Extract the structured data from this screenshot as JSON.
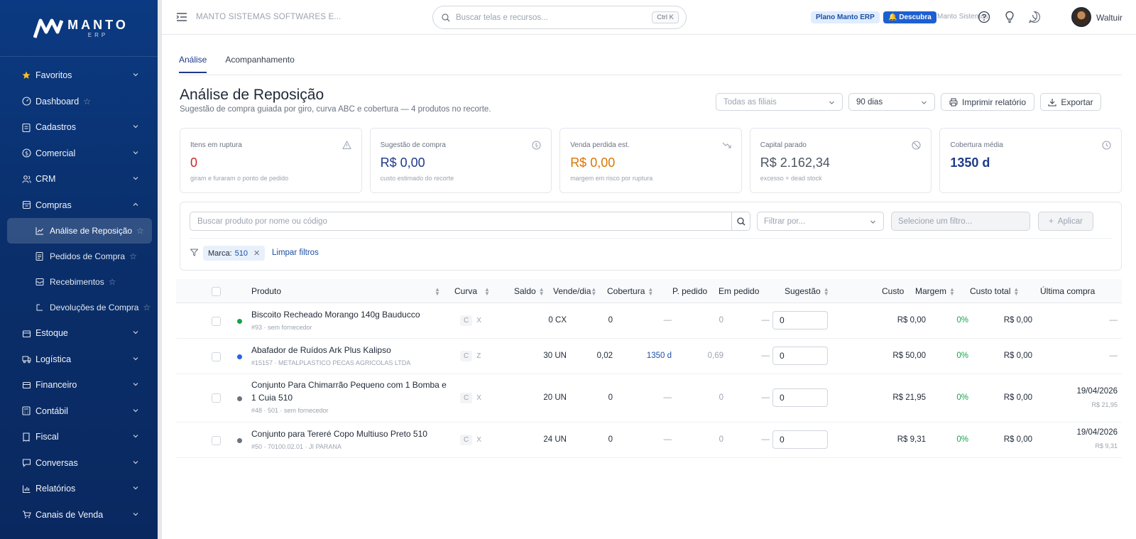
{
  "brand": {
    "name": "MANTO",
    "sub": "ERP"
  },
  "sidebar": {
    "items": [
      {
        "label": "Favoritos",
        "icon": "star-icon"
      },
      {
        "label": "Dashboard",
        "icon": "gauge-icon"
      },
      {
        "label": "Cadastros",
        "icon": "clipboard-icon"
      },
      {
        "label": "Comercial",
        "icon": "dollar-icon"
      },
      {
        "label": "CRM",
        "icon": "users-icon"
      },
      {
        "label": "Compras",
        "icon": "cart-icon"
      }
    ],
    "subitems": [
      {
        "label": "Análise de Reposição"
      },
      {
        "label": "Pedidos de Compra"
      },
      {
        "label": "Recebimentos"
      },
      {
        "label": "Devoluções de Compra"
      }
    ],
    "items_after": [
      {
        "label": "Estoque"
      },
      {
        "label": "Logística"
      },
      {
        "label": "Financeiro"
      },
      {
        "label": "Contábil"
      },
      {
        "label": "Fiscal"
      },
      {
        "label": "Conversas"
      },
      {
        "label": "Relatórios"
      },
      {
        "label": "Canais de Venda"
      }
    ]
  },
  "topbar": {
    "company": "MANTO SISTEMAS SOFTWARES E...",
    "search_placeholder": "Buscar telas e recursos...",
    "shortcut": "Ctrl K",
    "plan": "Plano Manto ERP",
    "discover": "Descubra",
    "tenant": "Manto Sistemas",
    "user": "Waltuir"
  },
  "tabs": [
    "Análise",
    "Acompanhamento"
  ],
  "page": {
    "title": "Análise de Reposição",
    "subtitle": "Sugestão de compra guiada por giro, curva ABC e cobertura — 4 produtos no recorte.",
    "branch_select": "Todas as filiais",
    "period_select": "90 dias",
    "print_label": "Imprimir relatório",
    "export_label": "Exportar"
  },
  "kpis": [
    {
      "label": "Itens em ruptura",
      "value": "0",
      "sub": "giram e furaram o ponto de pedido",
      "color": "#c62828"
    },
    {
      "label": "Sugestão de compra",
      "value": "R$ 0,00",
      "sub": "custo estimado do recorte",
      "color": "#1e3a8a"
    },
    {
      "label": "Venda perdida est.",
      "value": "R$ 0,00",
      "sub": "margem em risco por ruptura",
      "color": "#d97706"
    },
    {
      "label": "Capital parado",
      "value": "R$ 2.162,34",
      "sub": "excesso + dead stock",
      "color": "#4b5563"
    },
    {
      "label": "Cobertura média",
      "value": "1350 d",
      "sub": "",
      "color": "#1e3a8a"
    }
  ],
  "filters": {
    "search_placeholder": "Buscar produto por nome ou código",
    "filter_by": "Filtrar por...",
    "select_filter": "Selecione um filtro...",
    "apply": "Aplicar",
    "chip_key": "Marca:",
    "chip_value": "510",
    "clear": "Limpar filtros"
  },
  "table": {
    "headers": {
      "produto": "Produto",
      "curva": "Curva",
      "saldo": "Saldo",
      "vende": "Vende/dia",
      "cobertura": "Cobertura",
      "ppedido": "P. pedido",
      "empedido": "Em pedido",
      "sugestao": "Sugestão",
      "custo": "Custo",
      "margem": "Margem",
      "custo_total": "Custo total",
      "ultima": "Última compra"
    },
    "rows": [
      {
        "name": "Biscoito Recheado Morango 140g Bauducco",
        "name2": "",
        "meta": "#93 · sem fornecedor",
        "dot": "#16a34a",
        "curve": "C",
        "curve2": "X",
        "saldo": "0 CX",
        "vende": "0",
        "cobertura": "—",
        "ppedido": "0",
        "empedido": "—",
        "sugestao": "0",
        "custo": "R$ 0,00",
        "margem": "0%",
        "custo_total": "R$ 0,00",
        "ultima": "—",
        "ultima_sub": ""
      },
      {
        "name": "Abafador de Ruídos Ark Plus Kalipso",
        "name2": "",
        "meta": "#15157 · METALPLASTICO PECAS AGRICOLAS LTDA",
        "dot": "#2563eb",
        "curve": "C",
        "curve2": "Z",
        "saldo": "30 UN",
        "vende": "0,02",
        "cobertura": "1350 d",
        "ppedido": "0,69",
        "empedido": "—",
        "sugestao": "0",
        "custo": "R$ 50,00",
        "margem": "0%",
        "custo_total": "R$ 0,00",
        "ultima": "—",
        "ultima_sub": ""
      },
      {
        "name": "Conjunto Para Chimarrão Pequeno com 1 Bomba e",
        "name2": "1 Cuia 510",
        "meta": "#48 · 501 · sem fornecedor",
        "dot": "#6b7280",
        "curve": "C",
        "curve2": "X",
        "saldo": "20 UN",
        "vende": "0",
        "cobertura": "—",
        "ppedido": "0",
        "empedido": "—",
        "sugestao": "0",
        "custo": "R$ 21,95",
        "margem": "0%",
        "custo_total": "R$ 0,00",
        "ultima": "19/04/2026",
        "ultima_sub": "R$ 21,95"
      },
      {
        "name": "Conjunto para Tereré Copo Multiuso Preto 510",
        "name2": "",
        "meta": "#50 · 70100.02.01 · JI PARANA",
        "dot": "#6b7280",
        "curve": "C",
        "curve2": "X",
        "saldo": "24 UN",
        "vende": "0",
        "cobertura": "—",
        "ppedido": "0",
        "empedido": "—",
        "sugestao": "0",
        "custo": "R$ 9,31",
        "margem": "0%",
        "custo_total": "R$ 0,00",
        "ultima": "19/04/2026",
        "ultima_sub": "R$ 9,31"
      }
    ]
  }
}
